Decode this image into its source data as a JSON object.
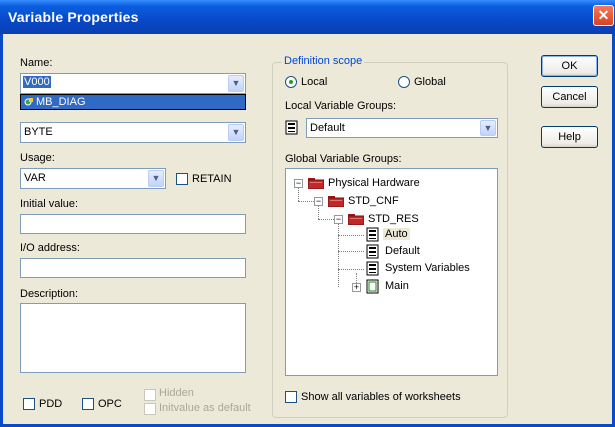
{
  "window": {
    "title": "Variable Properties",
    "close_glyph": "✕"
  },
  "left": {
    "name_label": "Name:",
    "name_value": "V000",
    "name_dropdown_item": "MB_DIAG",
    "datatype_value": "BYTE",
    "usage_label": "Usage:",
    "usage_value": "VAR",
    "retain_label": "RETAIN",
    "initial_value_label": "Initial value:",
    "initial_value": "",
    "io_address_label": "I/O address:",
    "io_address": "",
    "description_label": "Description:",
    "description": "",
    "pdd_label": "PDD",
    "opc_label": "OPC",
    "hidden_label": "Hidden",
    "initvalue_default_label": "Initvalue as default"
  },
  "scope": {
    "group_title": "Definition scope",
    "local_label": "Local",
    "global_label": "Global",
    "selected": "Local",
    "local_groups_label": "Local Variable Groups:",
    "local_groups_value": "Default",
    "global_groups_label": "Global Variable Groups:",
    "tree": {
      "physical_hardware": "Physical Hardware",
      "std_cnf": "STD_CNF",
      "std_res": "STD_RES",
      "auto": "Auto",
      "default": "Default",
      "system_variables": "System Variables",
      "main": "Main"
    },
    "show_all_label": "Show all variables of worksheets"
  },
  "buttons": {
    "ok": "OK",
    "cancel": "Cancel",
    "help": "Help",
    "expand_plus": "+",
    "expand_minus": "−"
  },
  "icons": {
    "folder": "folder-red-icon",
    "worksheet": "worksheet-stack-icon",
    "program": "program-icon",
    "dropdown": "▼"
  }
}
